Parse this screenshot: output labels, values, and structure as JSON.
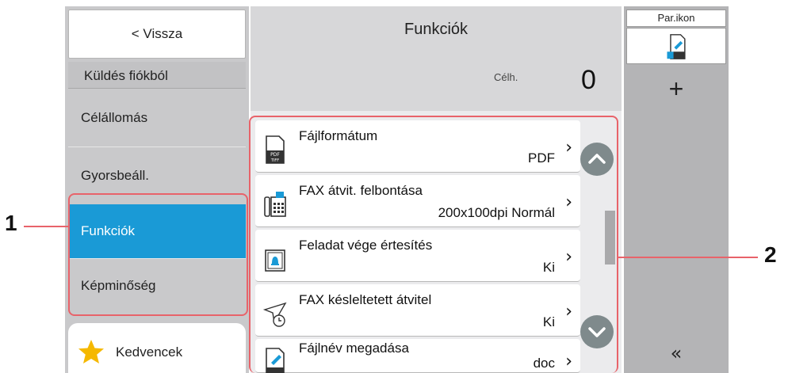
{
  "window": {
    "title": "Funkciók"
  },
  "sidebar": {
    "back_label": "< Vissza",
    "section_label": "Küldés fiókból",
    "items": [
      {
        "label": "Célállomás",
        "selected": false
      },
      {
        "label": "Gyorsbeáll.",
        "selected": false
      },
      {
        "label": "Funkciók",
        "selected": true
      },
      {
        "label": "Képminőség",
        "selected": false
      }
    ],
    "favorites_label": "Kedvencek"
  },
  "header": {
    "destination_label": "Célh.",
    "destination_count": "0"
  },
  "functions": [
    {
      "name": "Fájlformátum",
      "value": "PDF",
      "icon": "pdf-tiff-file-icon"
    },
    {
      "name": "FAX átvit. felbontása",
      "value": "200x100dpi Normál",
      "icon": "fax-resolution-icon"
    },
    {
      "name": "Feladat vége értesítés",
      "value": "Ki",
      "icon": "job-end-notification-icon"
    },
    {
      "name": "FAX késleltetett átvitel",
      "value": "Ki",
      "icon": "delayed-transmission-icon"
    },
    {
      "name": "Fájlnév megadása",
      "value": "doc",
      "icon": "file-name-icon"
    }
  ],
  "right_panel": {
    "shortcut_label": "Par.ikon",
    "add_symbol": "+",
    "collapse_symbol": "«"
  },
  "callouts": {
    "one": "1",
    "two": "2"
  },
  "colors": {
    "selected_tab": "#1a9ad6",
    "callout_outline": "#e8636a",
    "scroll_button": "#7f8a8c",
    "star": "#f5b800"
  }
}
